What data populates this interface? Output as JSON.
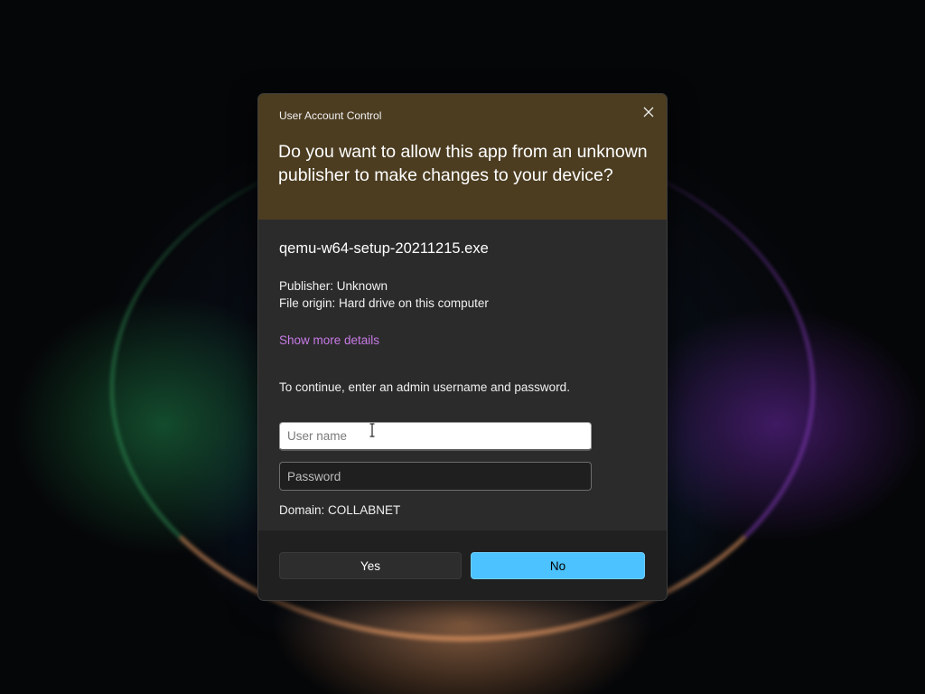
{
  "window": {
    "title": "User Account Control",
    "question": "Do you want to allow this app from an unknown publisher to make changes to your device?",
    "close_icon": "close-icon"
  },
  "app": {
    "name": "qemu-w64-setup-20211215.exe",
    "publisher": "Publisher: Unknown",
    "file_origin": "File origin: Hard drive on this computer",
    "details_link": "Show more details"
  },
  "credentials": {
    "instruction": "To continue, enter an admin username and password.",
    "username_placeholder": "User name",
    "username_value": "",
    "password_placeholder": "Password",
    "password_value": "",
    "domain": "Domain: COLLABNET"
  },
  "buttons": {
    "yes_label": "Yes",
    "no_label": "No"
  },
  "colors": {
    "header_bg": "#4c3d21",
    "dialog_bg": "#2b2b2b",
    "footer_bg": "#202020",
    "link": "#c77ae6",
    "primary_button": "#4cc2ff"
  }
}
